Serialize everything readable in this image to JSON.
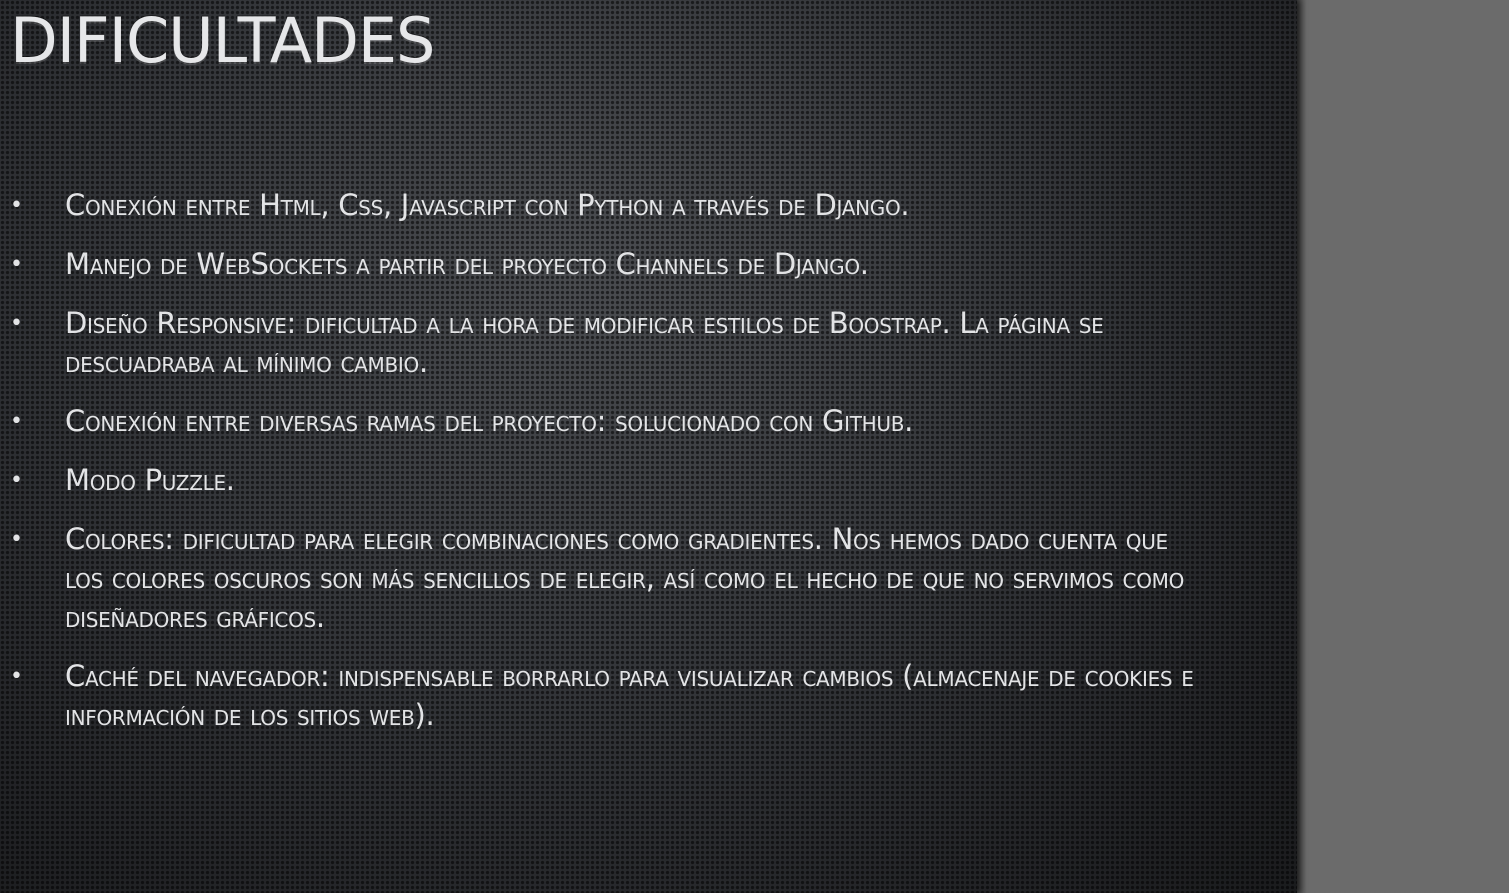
{
  "slide": {
    "title": "Dificultades",
    "bullet_symbol": "•",
    "bullets": [
      "Conexión entre Html, Css, Javascript con Python a través de Django.",
      "Manejo de WebSockets a partir del proyecto Channels de Django.",
      "Diseño Responsive: dificultad a la hora de modificar estilos de Boostrap. La página se descuadraba al mínimo cambio.",
      "Conexión entre diversas ramas del proyecto: solucionado con Github.",
      "Modo Puzzle.",
      "Colores: dificultad para elegir combinaciones como gradientes. Nos hemos dado cuenta que los colores oscuros son más sencillos de elegir, así como el hecho de que no servimos como diseñadores gráficos.",
      "Caché del navegador: indispensable borrarlo para visualizar cambios (almacenaje de cookies e información de los sitios web)."
    ]
  },
  "colors": {
    "slide_background": "#2f3134",
    "side_panel": "#6b6b6b",
    "text": "#e3e4e6"
  }
}
